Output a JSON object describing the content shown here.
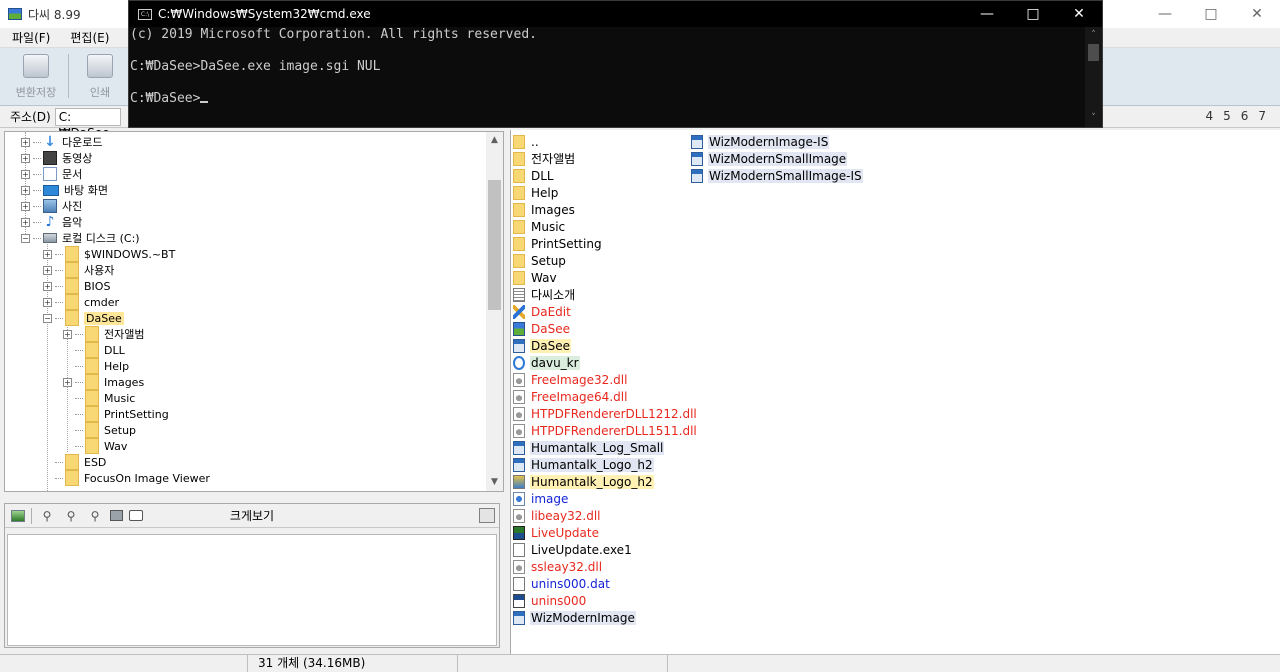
{
  "window": {
    "title": "다씨 8.99"
  },
  "menu": [
    "파일(F)",
    "편집(E)"
  ],
  "toolbar": [
    {
      "label": "변환저장",
      "icon": "save-convert-icon"
    },
    {
      "label": "인쇄",
      "icon": "print-icon"
    }
  ],
  "address": {
    "label": "주소(D)",
    "value": "C:₩DaSee",
    "pages": [
      "4",
      "5",
      "6",
      "7"
    ]
  },
  "tree": [
    {
      "label": "다운로드",
      "icon": "download-icon"
    },
    {
      "label": "동영상",
      "icon": "video-icon"
    },
    {
      "label": "문서",
      "icon": "document-icon"
    },
    {
      "label": "바탕 화면",
      "icon": "desktop-icon"
    },
    {
      "label": "사진",
      "icon": "pictures-icon"
    },
    {
      "label": "음악",
      "icon": "music-icon"
    },
    {
      "label": "로컬 디스크 (C:)",
      "icon": "drive-icon"
    },
    {
      "label": "$WINDOWS.~BT",
      "icon": "folder-icon"
    },
    {
      "label": "사용자",
      "icon": "folder-icon"
    },
    {
      "label": "BIOS",
      "icon": "folder-icon"
    },
    {
      "label": "cmder",
      "icon": "folder-icon"
    },
    {
      "label": "DaSee",
      "icon": "folder-icon",
      "selected": true
    },
    {
      "label": "전자앨범",
      "icon": "folder-icon"
    },
    {
      "label": "DLL",
      "icon": "folder-icon"
    },
    {
      "label": "Help",
      "icon": "folder-icon"
    },
    {
      "label": "Images",
      "icon": "folder-icon"
    },
    {
      "label": "Music",
      "icon": "folder-icon"
    },
    {
      "label": "PrintSetting",
      "icon": "folder-icon"
    },
    {
      "label": "Setup",
      "icon": "folder-icon"
    },
    {
      "label": "Wav",
      "icon": "folder-icon"
    },
    {
      "label": "ESD",
      "icon": "folder-icon"
    },
    {
      "label": "FocusOn Image Viewer",
      "icon": "folder-icon"
    }
  ],
  "preview": {
    "title": "크게보기"
  },
  "files_col1": [
    {
      "name": "..",
      "icon": "folder-up-icon"
    },
    {
      "name": "전자앨범",
      "icon": "folder-icon"
    },
    {
      "name": "DLL",
      "icon": "folder-icon"
    },
    {
      "name": "Help",
      "icon": "folder-icon"
    },
    {
      "name": "Images",
      "icon": "folder-icon"
    },
    {
      "name": "Music",
      "icon": "folder-icon"
    },
    {
      "name": "PrintSetting",
      "icon": "folder-icon"
    },
    {
      "name": "Setup",
      "icon": "folder-icon"
    },
    {
      "name": "Wav",
      "icon": "folder-icon"
    },
    {
      "name": "다씨소개",
      "icon": "text-file-icon"
    },
    {
      "name": "DaEdit",
      "icon": "daedit-app-icon",
      "color": "red"
    },
    {
      "name": "DaSee",
      "icon": "dasee-app-icon",
      "color": "red"
    },
    {
      "name": "DaSee",
      "icon": "image-file-icon",
      "hl": "hly"
    },
    {
      "name": "davu_kr",
      "icon": "davu-icon",
      "hl": "hlg"
    },
    {
      "name": "FreeImage32.dll",
      "icon": "dll-icon",
      "color": "red"
    },
    {
      "name": "FreeImage64.dll",
      "icon": "dll-icon",
      "color": "red"
    },
    {
      "name": "HTPDFRendererDLL1212.dll",
      "icon": "dll-icon",
      "color": "red"
    },
    {
      "name": "HTPDFRendererDLL1511.dll",
      "icon": "dll-icon",
      "color": "red"
    },
    {
      "name": "Humantalk_Log_Small",
      "icon": "image-file-icon",
      "hl": "hl"
    },
    {
      "name": "Humantalk_Logo_h2",
      "icon": "image-file-icon",
      "hl": "hl"
    },
    {
      "name": "Humantalk_Logo_h2",
      "icon": "humantalk-icon",
      "hl": "hly"
    },
    {
      "name": "image",
      "icon": "sgi-image-icon",
      "color": "blue"
    },
    {
      "name": "libeay32.dll",
      "icon": "dll-icon",
      "color": "red"
    },
    {
      "name": "LiveUpdate",
      "icon": "liveupdate-icon",
      "color": "red"
    },
    {
      "name": "LiveUpdate.exe1",
      "icon": "file-icon"
    },
    {
      "name": "ssleay32.dll",
      "icon": "dll-icon",
      "color": "red"
    },
    {
      "name": "unins000.dat",
      "icon": "file-icon",
      "color": "blue"
    },
    {
      "name": "unins000",
      "icon": "uninstall-icon",
      "color": "red"
    },
    {
      "name": "WizModernImage",
      "icon": "image-file-icon",
      "hl": "hl"
    }
  ],
  "files_col2": [
    {
      "name": "WizModernImage-IS",
      "icon": "image-file-icon",
      "hl": "hl"
    },
    {
      "name": "WizModernSmallImage",
      "icon": "image-file-icon",
      "hl": "hl"
    },
    {
      "name": "WizModernSmallImage-IS",
      "icon": "image-file-icon",
      "hl": "hl"
    }
  ],
  "status": {
    "count": "31 개체 (34.16MB)"
  },
  "cmd": {
    "title": "C:₩Windows₩System32₩cmd.exe",
    "icon_text": "C:\\",
    "lines": [
      "(c) 2019 Microsoft Corporation. All rights reserved.",
      "C:₩DaSee>DaSee.exe image.sgi NUL",
      "C:₩DaSee>"
    ]
  },
  "colors": {
    "red": "#e8281e",
    "blue": "#1523d6",
    "selected_folder": "#ffe79a"
  }
}
